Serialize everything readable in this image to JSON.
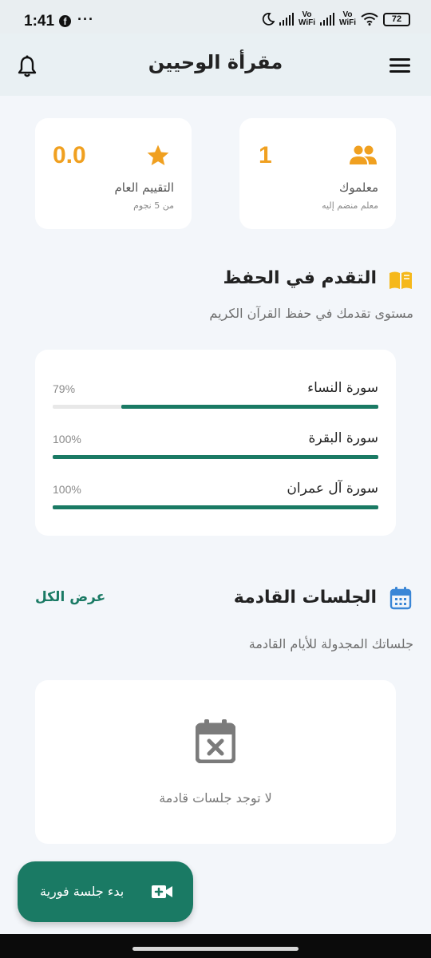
{
  "status_bar": {
    "time": "1:41",
    "notification_icons": [
      "facebook-icon",
      "more-dots-icon"
    ],
    "vo_wifi_label": "Vo\nWiFi",
    "battery": "72"
  },
  "header": {
    "title": "مقرأة الوحيين"
  },
  "stats": {
    "rating": {
      "value": "0.0",
      "label": "التقييم العام",
      "sub": "من 5 نجوم"
    },
    "teachers": {
      "value": "1",
      "label": "معلموك",
      "sub": "معلم منضم إليه"
    }
  },
  "progress_section": {
    "title": "التقدم في الحفظ",
    "subtitle": "مستوى تقدمك في حفظ القرآن الكريم",
    "items": [
      {
        "name": "سورة النساء",
        "percent_label": "79%",
        "percent": 79
      },
      {
        "name": "سورة البقرة",
        "percent_label": "100%",
        "percent": 100
      },
      {
        "name": "سورة آل عمران",
        "percent_label": "100%",
        "percent": 100
      }
    ]
  },
  "sessions_section": {
    "title": "الجلسات القادمة",
    "view_all": "عرض الكل",
    "subtitle": "جلساتك المجدولة للأيام القادمة",
    "empty_text": "لا توجد جلسات قادمة"
  },
  "fab": {
    "label": "بدء جلسة فورية"
  },
  "colors": {
    "accent": "#1a7a64",
    "star": "#f0a020",
    "book": "#f5b81b",
    "calendar": "#3a86d6"
  }
}
